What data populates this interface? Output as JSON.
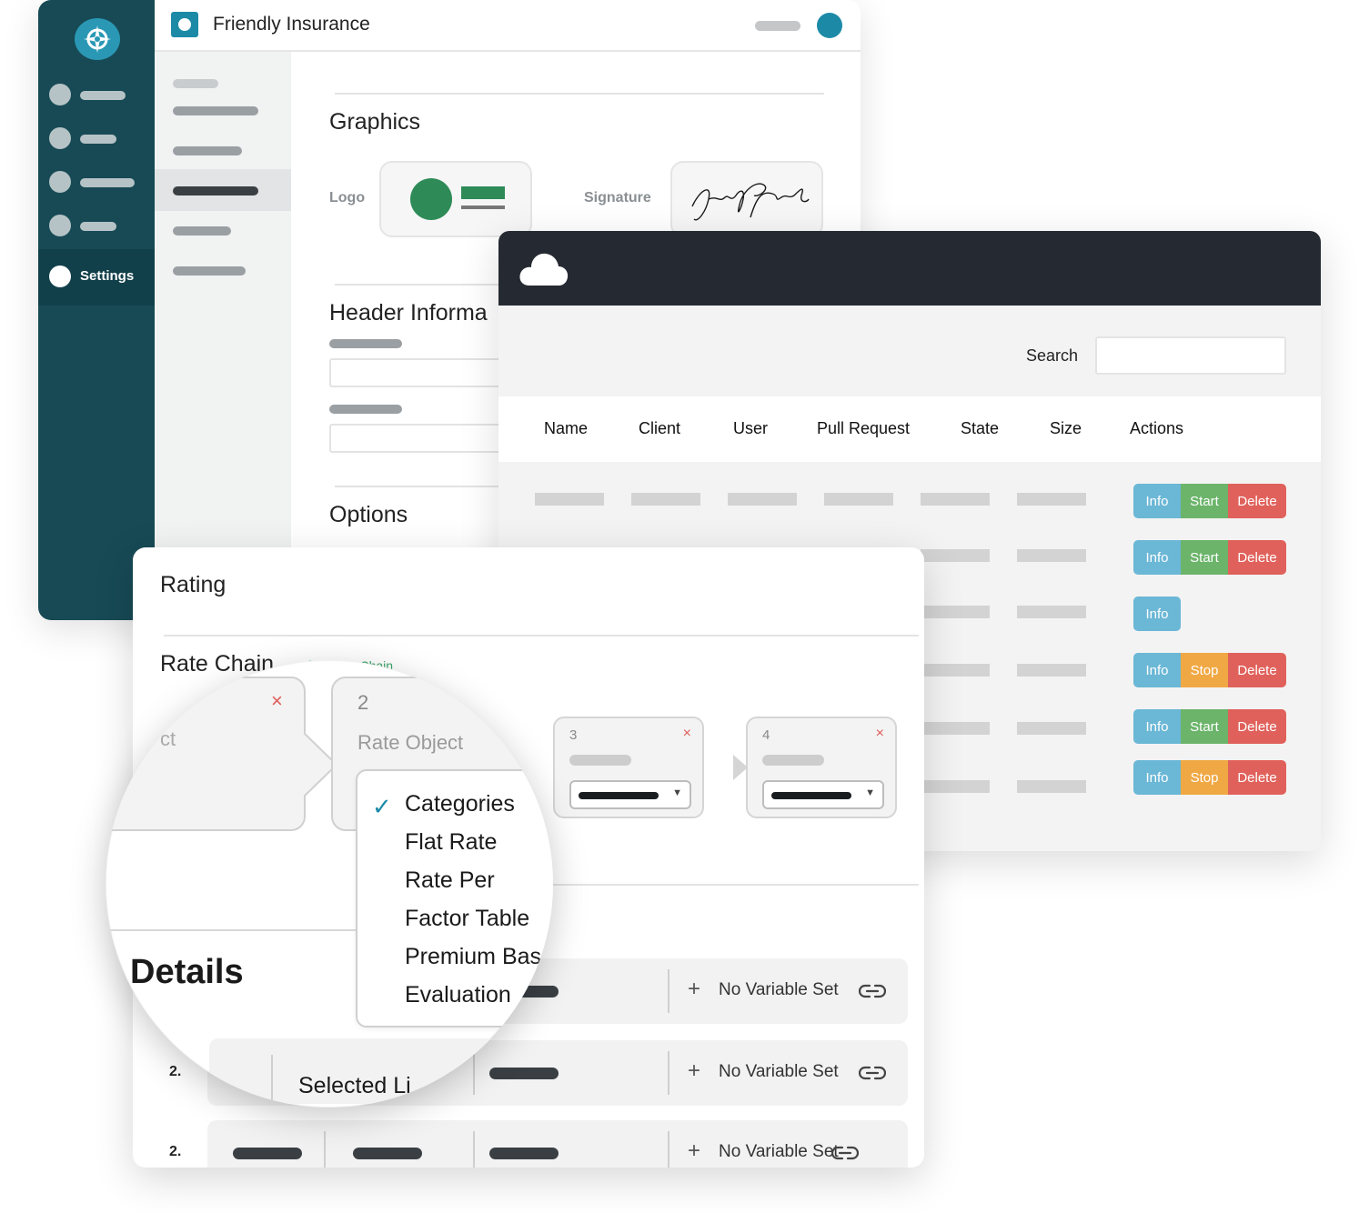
{
  "settings_app": {
    "title": "Friendly Insurance",
    "sidebar_active_label": "Settings",
    "sections": {
      "graphics": "Graphics",
      "header": "Header Informa",
      "options": "Options"
    },
    "fields": {
      "logo": "Logo",
      "signature": "Signature"
    }
  },
  "table_app": {
    "search_label": "Search",
    "search_value": "",
    "columns": [
      "Name",
      "Client",
      "User",
      "Pull Request",
      "State",
      "Size",
      "Actions"
    ],
    "rows": [
      {
        "actions": [
          "Info",
          "Start",
          "Delete"
        ]
      },
      {
        "actions": [
          "Info",
          "Start",
          "Delete"
        ]
      },
      {
        "actions": [
          "Info"
        ]
      },
      {
        "actions": [
          "Info",
          "Stop",
          "Delete"
        ]
      },
      {
        "actions": [
          "Info",
          "Start",
          "Delete"
        ]
      },
      {
        "actions": [
          "Info",
          "Stop",
          "Delete"
        ]
      }
    ]
  },
  "rating_app": {
    "title": "Rating",
    "rate_chain_title": "Rate Chain",
    "add_to_chain": "Add to Chain",
    "chain": [
      {
        "num": "2",
        "label": "Rate Object"
      },
      {
        "num": "3"
      },
      {
        "num": "4"
      }
    ],
    "chain_partial_label": "ct",
    "close_glyph": "×",
    "dropdown_options": [
      "Categories",
      "Flat Rate",
      "Rate Per",
      "Factor Table",
      "Premium Bas",
      "Evaluation"
    ],
    "dropdown_selected": "Categories",
    "details_title": "Details",
    "rows": [
      {
        "num": "",
        "variable": "No Variable Set"
      },
      {
        "num": "2.",
        "label": "Selected Li",
        "variable": "No Variable Set"
      },
      {
        "num": "2.",
        "variable": "No Variable Set"
      }
    ]
  }
}
